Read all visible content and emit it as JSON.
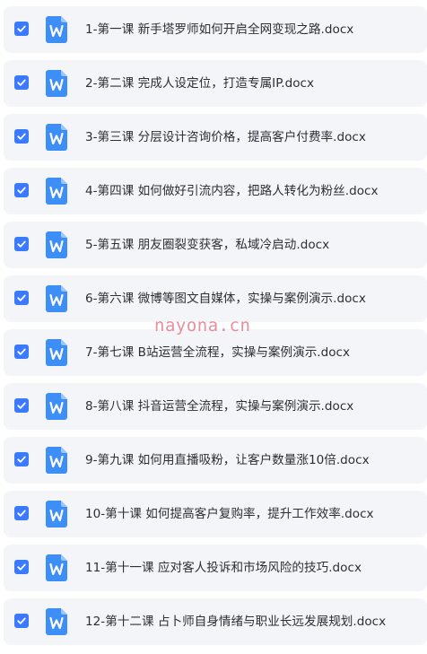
{
  "watermark": "nayona.cn",
  "colors": {
    "checkbox": "#3a7afe",
    "row_background": "#f4f5f8",
    "file_icon": "#3d8ef7",
    "text": "#2b2f36"
  },
  "file_icon_name": "word-doc-icon",
  "files": [
    {
      "name": "1-第一课 新手塔罗师如何开启全网变现之路.docx",
      "checked": true
    },
    {
      "name": "2-第二课 完成人设定位，打造专属IP.docx",
      "checked": true
    },
    {
      "name": "3-第三课 分层设计咨询价格，提高客户付费率.docx",
      "checked": true
    },
    {
      "name": "4-第四课 如何做好引流内容，把路人转化为粉丝.docx",
      "checked": true
    },
    {
      "name": "5-第五课 朋友圈裂变获客，私域冷启动.docx",
      "checked": true
    },
    {
      "name": "6-第六课 微博等图文自媒体，实操与案例演示.docx",
      "checked": true
    },
    {
      "name": "7-第七课 B站运营全流程，实操与案例演示.docx",
      "checked": true
    },
    {
      "name": "8-第八课 抖音运营全流程，实操与案例演示.docx",
      "checked": true
    },
    {
      "name": "9-第九课 如何用直播吸粉，让客户数量涨10倍.docx",
      "checked": true
    },
    {
      "name": "10-第十课 如何提高客户复购率，提升工作效率.docx",
      "checked": true
    },
    {
      "name": "11-第十一课 应对客人投诉和市场风险的技巧.docx",
      "checked": true
    },
    {
      "name": "12-第十二课 占卜师自身情绪与职业长远发展规划.docx",
      "checked": true
    }
  ]
}
